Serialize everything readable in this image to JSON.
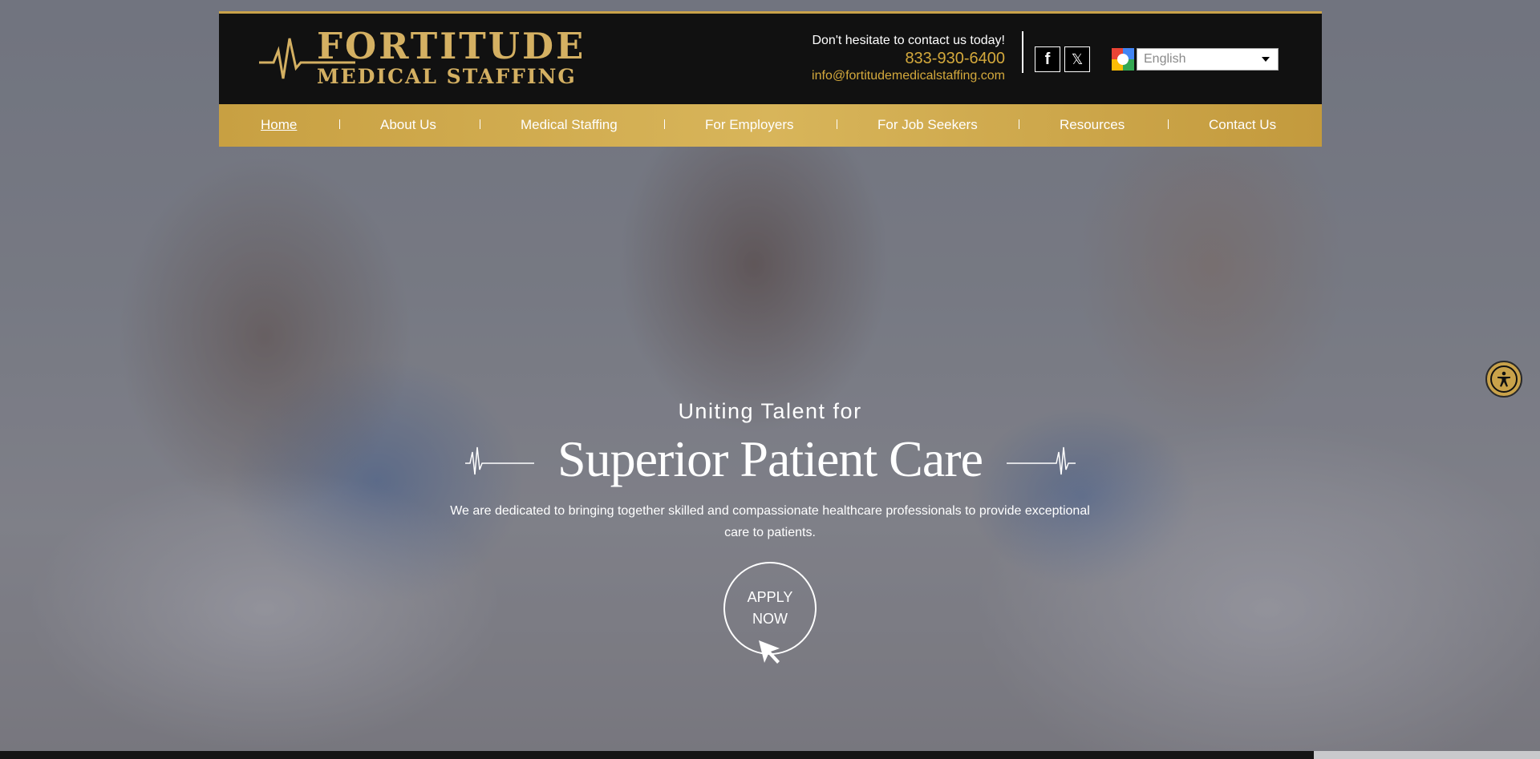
{
  "brand": {
    "name_line1": "FORTITUDE",
    "name_line2": "MEDICAL STAFFING",
    "accent_color": "#d4b062"
  },
  "header": {
    "tagline": "Don't hesitate to contact us today!",
    "phone": "833-930-6400",
    "email": "info@fortitudemedicalstaffing.com",
    "social": {
      "facebook_label": "f",
      "x_label": "𝕏"
    },
    "language": {
      "selected": "English"
    }
  },
  "nav": {
    "items": [
      {
        "label": "Home"
      },
      {
        "label": "About Us"
      },
      {
        "label": "Medical Staffing"
      },
      {
        "label": "For Employers"
      },
      {
        "label": "For Job Seekers"
      },
      {
        "label": "Resources"
      },
      {
        "label": "Contact Us"
      }
    ],
    "active": "Home"
  },
  "hero": {
    "subtitle": "Uniting Talent for",
    "title": "Superior Patient Care",
    "description": "We are dedicated to bringing together skilled and compassionate healthcare professionals to provide exceptional care to patients.",
    "cta_line1": "APPLY",
    "cta_line2": "NOW"
  },
  "icons": [
    "heartbeat-icon",
    "facebook-icon",
    "x-icon",
    "google-translate-icon",
    "chevron-down-icon",
    "accessibility-icon",
    "cursor-arrow-icon"
  ]
}
